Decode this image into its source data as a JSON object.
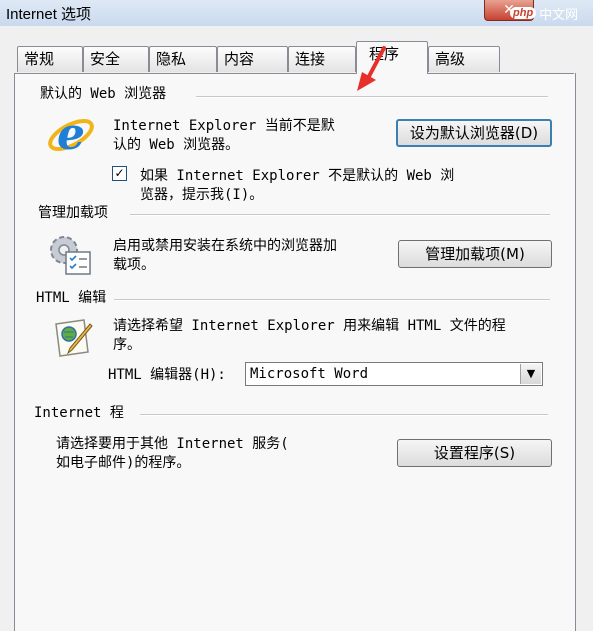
{
  "window": {
    "title": "Internet 选项",
    "close_glyph": "✕",
    "watermark": {
      "logo": "php",
      "text": "中文网"
    }
  },
  "tabs": [
    {
      "label": "常规"
    },
    {
      "label": "安全"
    },
    {
      "label": "隐私"
    },
    {
      "label": "内容"
    },
    {
      "label": "连接"
    },
    {
      "label": "程序",
      "active": true
    },
    {
      "label": "高级"
    }
  ],
  "default_browser": {
    "heading": "默认的 Web 浏览器",
    "description_line1": "Internet Explorer 当前不是默",
    "description_line2": "认的 Web 浏览器。",
    "set_default_button": "设为默认浏览器(D)",
    "checkbox_checked": true,
    "checkbox_glyph": "✓",
    "checkbox_line1": "如果 Internet Explorer 不是默认的 Web 浏",
    "checkbox_line2": "览器，提示我(I)。",
    "icon": "internet-explorer-icon"
  },
  "addons": {
    "heading": "管理加载项",
    "description_line1": "启用或禁用安装在系统中的浏览器加",
    "description_line2": "载项。",
    "button": "管理加载项(M)",
    "icon": "gear-checklist-icon"
  },
  "html_editing": {
    "heading": "HTML 编辑",
    "description_line1": "请选择希望 Internet Explorer 用来编辑 HTML 文件的程",
    "description_line2": "序。",
    "editor_label": "HTML 编辑器(H):",
    "editor_value": "Microsoft Word",
    "dropdown_glyph": "▼",
    "icon": "document-pen-icon"
  },
  "internet_programs": {
    "heading": "Internet 程",
    "description_line1": "请选择要用于其他 Internet 服务(",
    "description_line2": "如电子邮件)的程序。",
    "button": "设置程序(S)"
  },
  "colors": {
    "annotation_arrow": "#e8302a",
    "ie_blue": "#1f7fd6",
    "ie_ring": "#f2b519"
  }
}
